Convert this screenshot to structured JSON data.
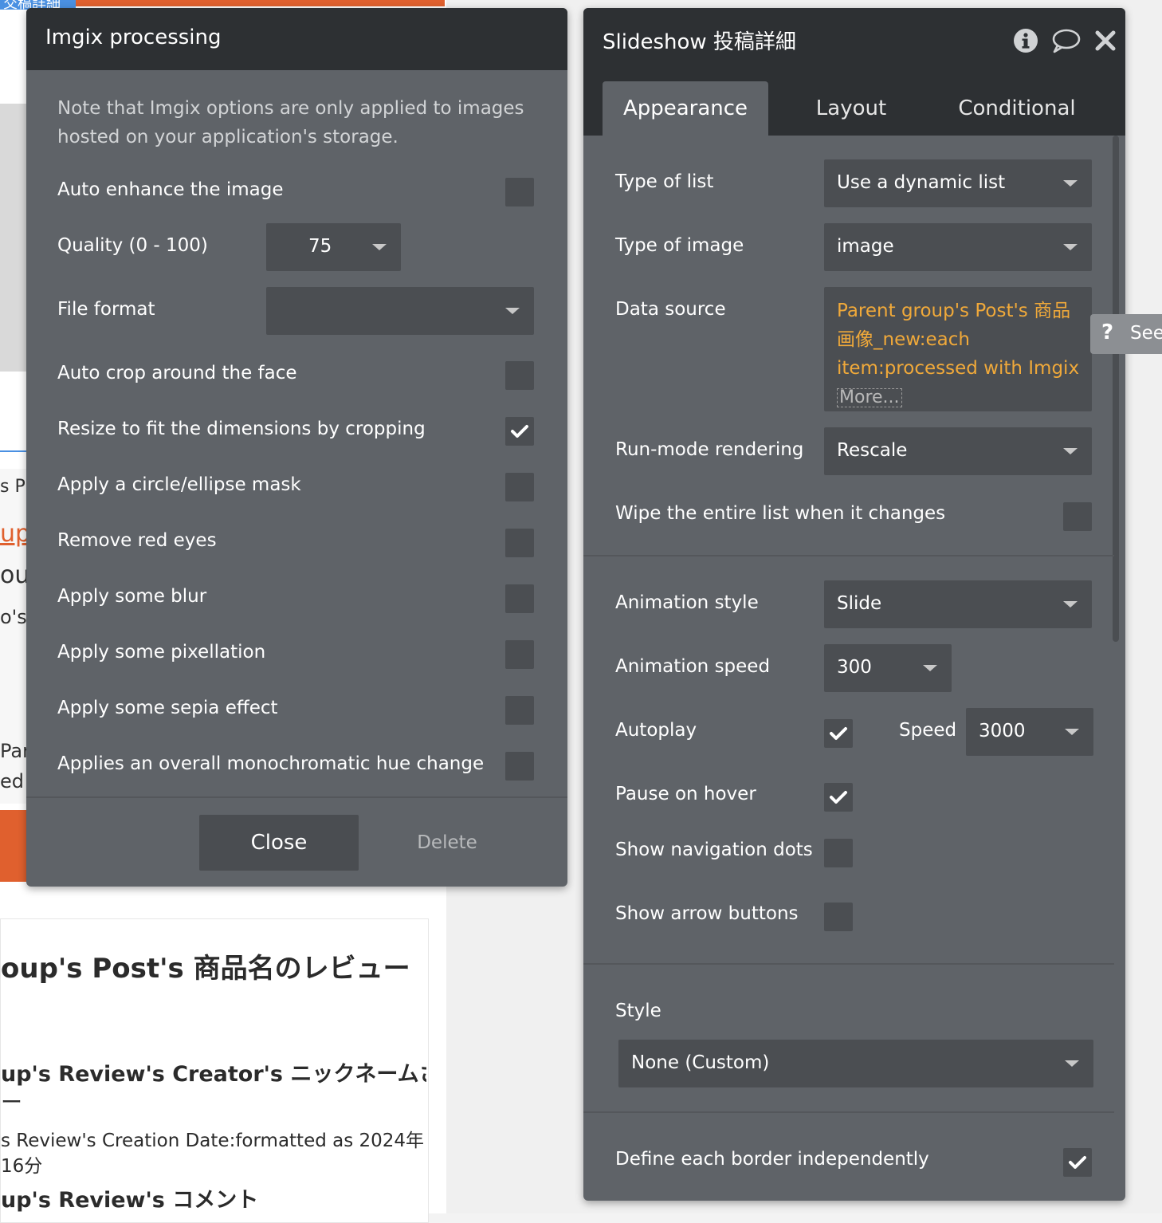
{
  "background": {
    "tab_fragment": "交稿詳細",
    "left_fragments": [
      "s P",
      "up",
      "ou",
      "o's",
      "Par",
      "ed"
    ],
    "card": {
      "title": "oup's Post's 商品名のレビュー",
      "creator": "up's Review's Creator's ニックネームさ",
      "dash": "ー",
      "date": "s Review's Creation Date:formatted as 2024年",
      "time": "16分",
      "comment": "up's Review's コメント"
    }
  },
  "imgix_panel": {
    "title": "Imgix processing",
    "note": "Note that Imgix options are only applied to images hosted on your application's storage.",
    "auto_enhance": {
      "label": "Auto enhance the image",
      "checked": false
    },
    "quality": {
      "label": "Quality (0 - 100)",
      "value": "75"
    },
    "file_format": {
      "label": "File format",
      "value": ""
    },
    "auto_crop": {
      "label": "Auto crop around the face",
      "checked": false
    },
    "resize_crop": {
      "label": "Resize to fit the dimensions by cropping",
      "checked": true
    },
    "circle_mask": {
      "label": "Apply a circle/ellipse mask",
      "checked": false
    },
    "red_eyes": {
      "label": "Remove red eyes",
      "checked": false
    },
    "blur": {
      "label": "Apply some blur",
      "checked": false
    },
    "pixellation": {
      "label": "Apply some pixellation",
      "checked": false
    },
    "sepia": {
      "label": "Apply some sepia effect",
      "checked": false
    },
    "hue": {
      "label": "Applies an overall monochromatic hue change",
      "checked": false
    },
    "close_label": "Close",
    "delete_label": "Delete"
  },
  "slideshow_panel": {
    "title": "Slideshow 投稿詳細",
    "tabs": [
      {
        "label": "Appearance",
        "active": true
      },
      {
        "label": "Layout",
        "active": false
      },
      {
        "label": "Conditional",
        "active": false
      }
    ],
    "type_of_list": {
      "label": "Type of list",
      "value": "Use a dynamic list"
    },
    "type_of_image": {
      "label": "Type of image",
      "value": "image"
    },
    "data_source": {
      "label": "Data source",
      "value": "Parent group's Post's 商品画像_new:each item:processed with Imgix",
      "more": "More..."
    },
    "run_mode": {
      "label": "Run-mode rendering",
      "value": "Rescale"
    },
    "wipe_list": {
      "label": "Wipe the entire list when it changes",
      "checked": false
    },
    "animation_style": {
      "label": "Animation style",
      "value": "Slide"
    },
    "animation_speed": {
      "label": "Animation speed",
      "value": "300"
    },
    "autoplay": {
      "label": "Autoplay",
      "checked": true,
      "speed_label": "Speed",
      "speed_value": "3000"
    },
    "pause_hover": {
      "label": "Pause on hover",
      "checked": true
    },
    "nav_dots": {
      "label": "Show navigation dots",
      "checked": false
    },
    "arrow_buttons": {
      "label": "Show arrow buttons",
      "checked": false
    },
    "style": {
      "label": "Style",
      "value": "None (Custom)"
    },
    "define_border": {
      "label": "Define each border independently",
      "checked": true
    }
  },
  "see_tab": {
    "icon": "question-icon",
    "label": "See"
  },
  "colors": {
    "header": "#2d3033",
    "panel": "#5f6368",
    "field": "#4b4e52",
    "accent_orange": "#f0a93a",
    "brand_orange": "#e0602e"
  }
}
